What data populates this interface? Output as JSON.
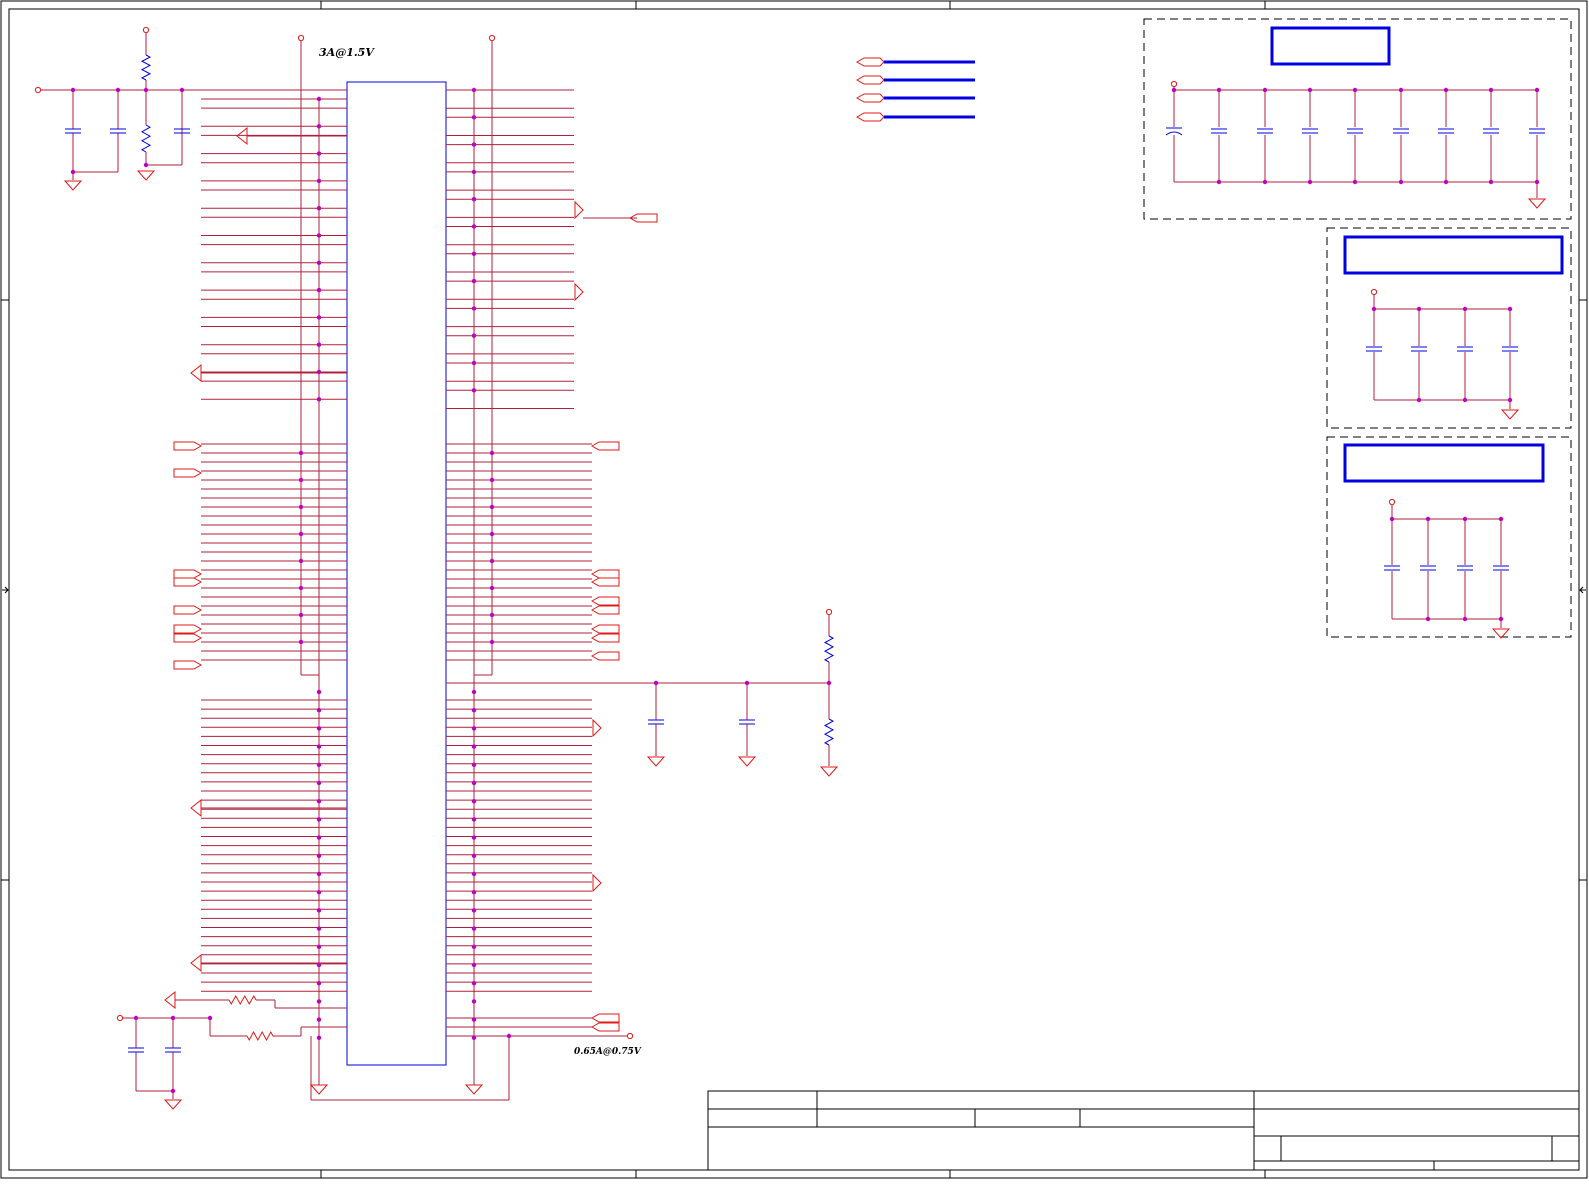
{
  "annotations": {
    "current_top": "3A@1.5V",
    "current_bottom": "0.65A@0.75V"
  },
  "colors": {
    "wire": "#b0203c",
    "part": "#e01818",
    "pin": "#c000c0",
    "body": "#0000e0",
    "frame": "#000000",
    "background": "#ffffff"
  },
  "icons": [
    "power-port-icon",
    "ground-icon",
    "capacitor-icon",
    "resistor-icon",
    "off-page-connector-icon",
    "junction-dot-icon"
  ]
}
